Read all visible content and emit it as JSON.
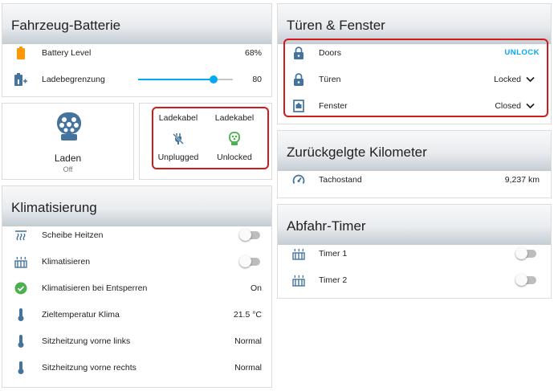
{
  "battery_card": {
    "title": "Fahrzeug-Batterie",
    "battery_level": {
      "label": "Battery Level",
      "value": "68%"
    },
    "charge_limit": {
      "label": "Ladebegrenzung",
      "value": "80",
      "fraction": 0.8
    }
  },
  "charge_card": {
    "name": "Laden",
    "state": "Off"
  },
  "cable_card": {
    "col1": {
      "title": "Ladekabel",
      "state": "Unplugged"
    },
    "col2": {
      "title": "Ladekabel",
      "state": "Unlocked"
    }
  },
  "climate_card": {
    "title": "Klimatisierung",
    "rows": [
      {
        "label": "Scheibe Heitzen",
        "type": "toggle"
      },
      {
        "label": "Klimatisieren",
        "type": "toggle"
      },
      {
        "label": "Klimatisieren bei Entsperren",
        "value": "On"
      },
      {
        "label": "Zieltemperatur Klima",
        "value": "21.5 °C"
      },
      {
        "label": "Sitzheitzung vorne links",
        "value": "Normal"
      },
      {
        "label": "Sitzheitzung vorne rechts",
        "value": "Normal"
      }
    ]
  },
  "doors_card": {
    "title": "Türen & Fenster",
    "doors": {
      "label": "Doors",
      "action": "UNLOCK"
    },
    "tueren": {
      "label": "Türen",
      "value": "Locked"
    },
    "fenster": {
      "label": "Fenster",
      "value": "Closed"
    }
  },
  "km_card": {
    "title": "Zurückgelgte Kilometer",
    "odometer": {
      "label": "Tachostand",
      "value": "9,237 km"
    }
  },
  "timer_card": {
    "title": "Abfahr-Timer",
    "rows": [
      {
        "label": "Timer 1"
      },
      {
        "label": "Timer 2"
      }
    ]
  },
  "colors": {
    "accent": "#03a9f4",
    "icon": "#44739e",
    "battery": "#ff9800",
    "ok": "#4caf50",
    "highlight": "#d11a1a"
  }
}
